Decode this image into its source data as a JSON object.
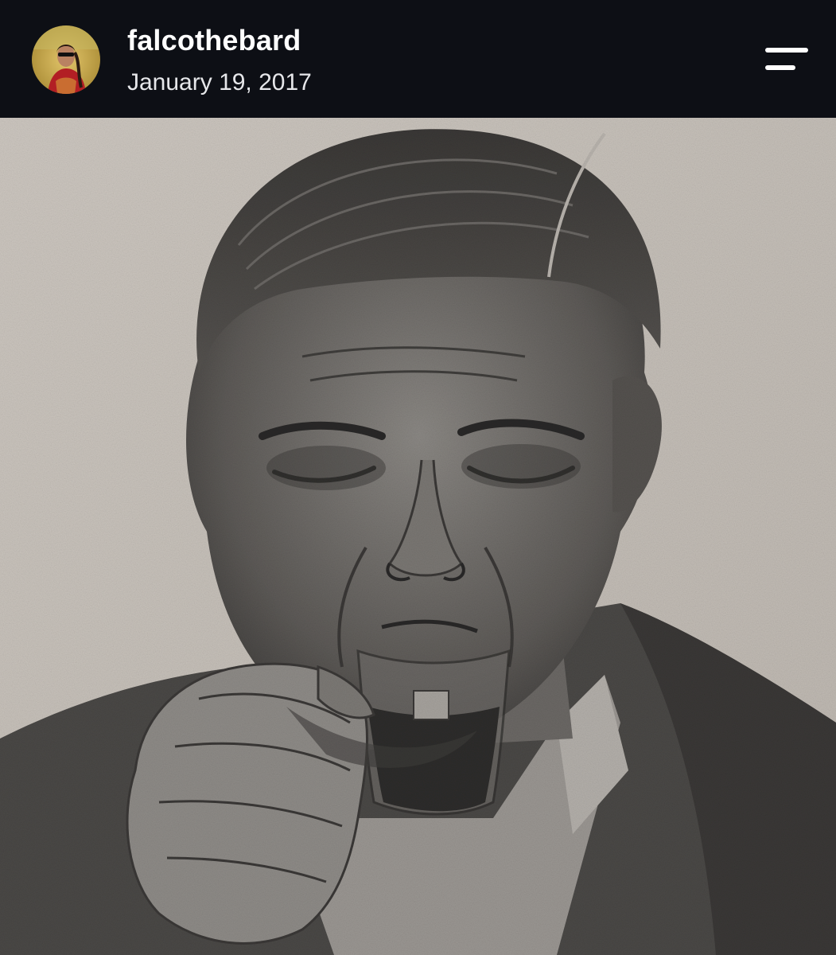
{
  "post": {
    "username": "falcothebard",
    "date": "January 19, 2017"
  },
  "icons": {
    "menu": "menu-icon",
    "avatar": "profile-avatar"
  },
  "colors": {
    "header_bg": "#0d0f15",
    "username_text": "#ffffff",
    "date_text": "#e6e7ea",
    "paper": "#c9c4bd"
  }
}
